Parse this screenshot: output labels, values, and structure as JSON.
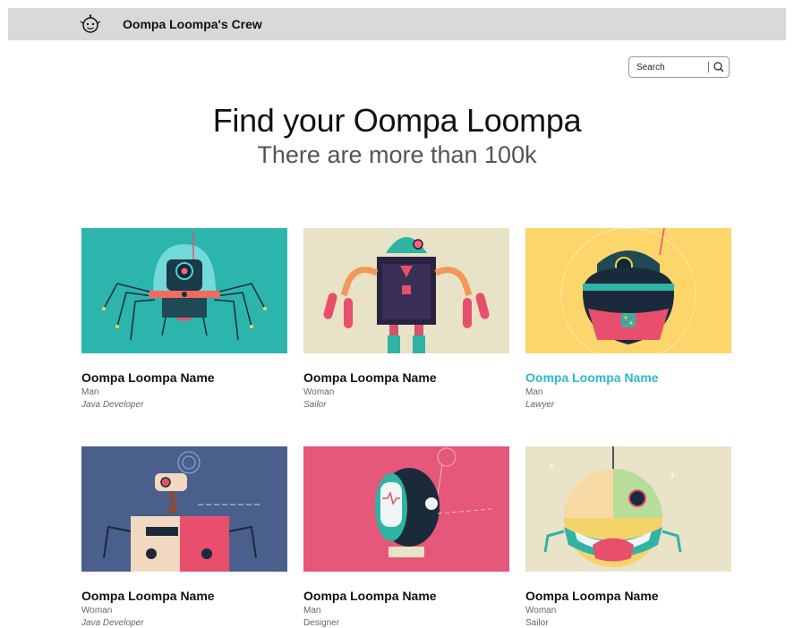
{
  "header": {
    "brand": "Oompa Loompa's Crew",
    "logo_icon": "robot-face-icon"
  },
  "search": {
    "placeholder": "Search",
    "icon": "search-icon"
  },
  "hero": {
    "title": "Find your Oompa Loompa",
    "subtitle": "There are more than 100k"
  },
  "colors": {
    "topbar": "#d9d9d9",
    "accent": "#2eb8cc"
  },
  "cards": [
    {
      "name": "Oompa Loompa Name",
      "gender": "Man",
      "profession": "Java Developer",
      "bg": "#2bb5ad",
      "highlighted": false
    },
    {
      "name": "Oompa Loompa Name",
      "gender": "Woman",
      "profession": "Sailor",
      "bg": "#e8e2c6",
      "highlighted": false
    },
    {
      "name": "Oompa Loompa Name",
      "gender": "Man",
      "profession": "Lawyer",
      "bg": "#fcd66a",
      "highlighted": true
    },
    {
      "name": "Oompa Loompa Name",
      "gender": "Woman",
      "profession": "Java Developer",
      "bg": "#4a5f8c",
      "highlighted": false
    },
    {
      "name": "Oompa Loompa Name",
      "gender": "Man",
      "profession": "Designer",
      "bg": "#e5587a",
      "highlighted": false
    },
    {
      "name": "Oompa Loompa Name",
      "gender": "Woman",
      "profession": "Sailor",
      "bg": "#e9e3c9",
      "highlighted": false
    }
  ]
}
